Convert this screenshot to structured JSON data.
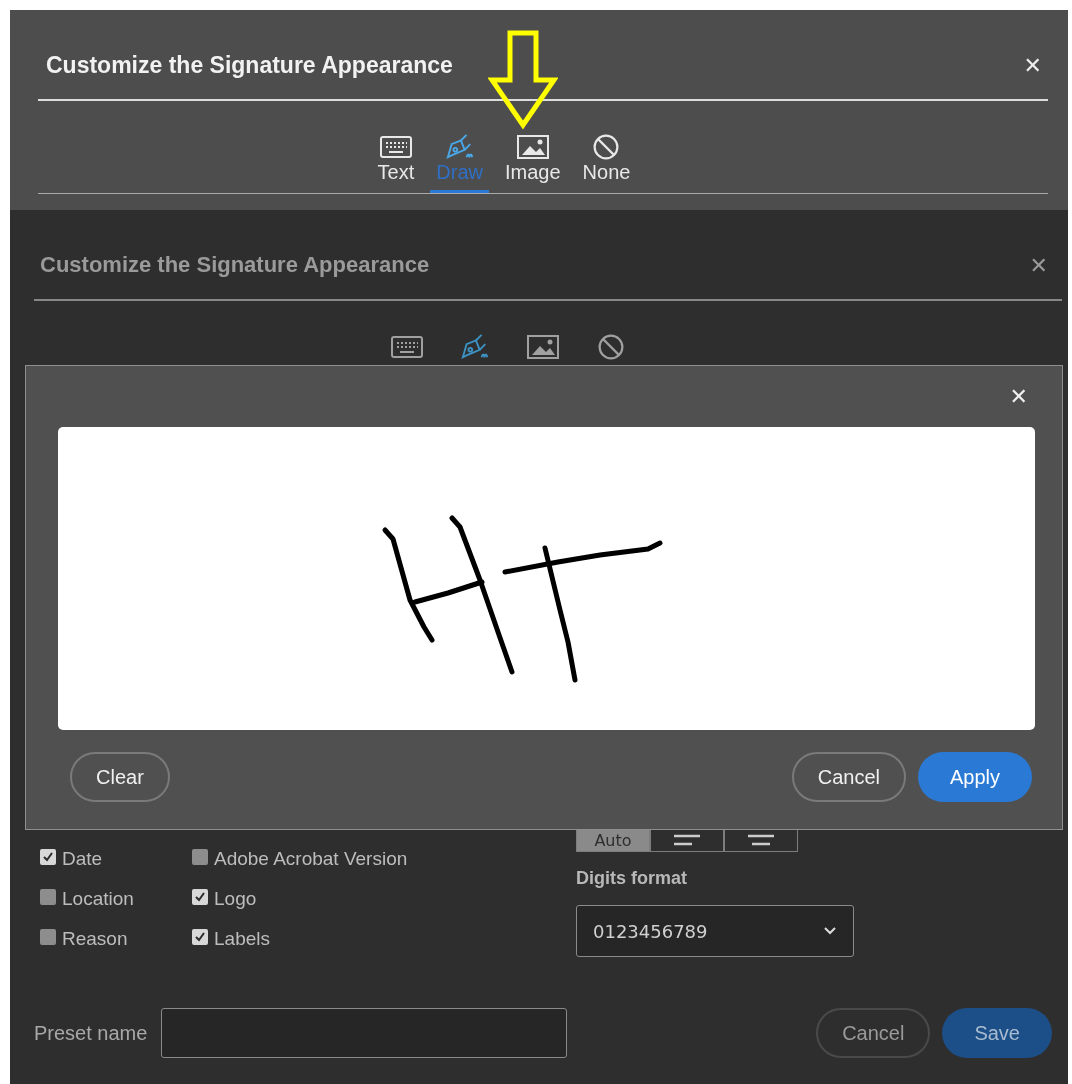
{
  "top_dialog": {
    "title": "Customize the Signature Appearance",
    "close": "✕",
    "tabs": [
      {
        "kind": "keyboard",
        "label": "Text",
        "selected": false
      },
      {
        "kind": "pen",
        "label": "Draw",
        "selected": true
      },
      {
        "kind": "image",
        "label": "Image",
        "selected": false
      },
      {
        "kind": "none",
        "label": "None",
        "selected": false
      }
    ]
  },
  "background_dialog": {
    "title": "Customize the Signature Appearance",
    "close": "✕",
    "tabs": [
      {
        "kind": "keyboard",
        "selected": false
      },
      {
        "kind": "pen",
        "selected": true
      },
      {
        "kind": "image",
        "selected": false
      },
      {
        "kind": "none",
        "selected": false
      }
    ],
    "show_options": [
      {
        "label": "Date",
        "checked": true
      },
      {
        "label": "Location",
        "checked": false
      },
      {
        "label": "Reason",
        "checked": false
      },
      {
        "label": "Adobe Acrobat Version",
        "checked": false
      },
      {
        "label": "Logo",
        "checked": true
      },
      {
        "label": "Labels",
        "checked": true
      }
    ],
    "alignment": [
      {
        "kind": "auto",
        "label": "Auto",
        "selected": true
      },
      {
        "kind": "left",
        "selected": false
      },
      {
        "kind": "center",
        "selected": false
      }
    ],
    "digits_format": {
      "label": "Digits format",
      "value": "0123456789"
    },
    "preset_name": {
      "label": "Preset name"
    },
    "buttons": [
      {
        "label": "Cancel",
        "kind": "secondary"
      },
      {
        "label": "Save",
        "kind": "primary"
      }
    ]
  },
  "draw_dialog": {
    "close": "✕",
    "buttons": [
      {
        "label": "Clear",
        "kind": "secondary"
      },
      {
        "label": "Cancel",
        "kind": "secondary"
      },
      {
        "label": "Apply",
        "kind": "primary"
      }
    ]
  }
}
